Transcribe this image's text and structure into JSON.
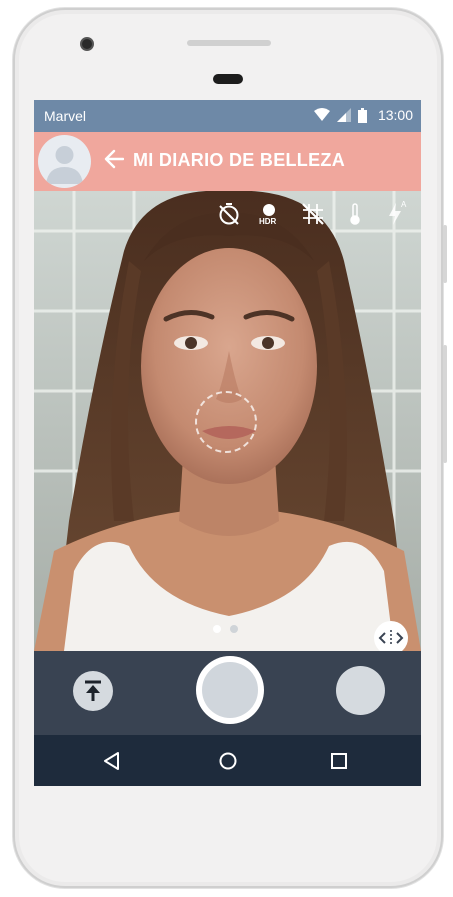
{
  "status_bar": {
    "carrier": "Marvel",
    "time": "13:00",
    "background": "#6e89a7"
  },
  "app_bar": {
    "title": "MI DIARIO DE BELLEZA",
    "background": "#f0a79d"
  },
  "camera_toolbar": {
    "hdr_label": "HDR",
    "flash_label": "A",
    "icons": [
      "timer-off-icon",
      "hdr-icon",
      "grid-off-icon",
      "thermometer-icon",
      "flash-auto-icon"
    ]
  },
  "preview": {
    "page_count": 2,
    "active_page": 1
  },
  "controls": {
    "background": "#394352",
    "icons": [
      "upload-icon",
      "shutter-icon",
      "gallery-icon"
    ]
  },
  "nav_bar": {
    "background": "#1e2b3c",
    "icons": [
      "back-triangle-icon",
      "home-circle-icon",
      "recents-square-icon"
    ]
  }
}
